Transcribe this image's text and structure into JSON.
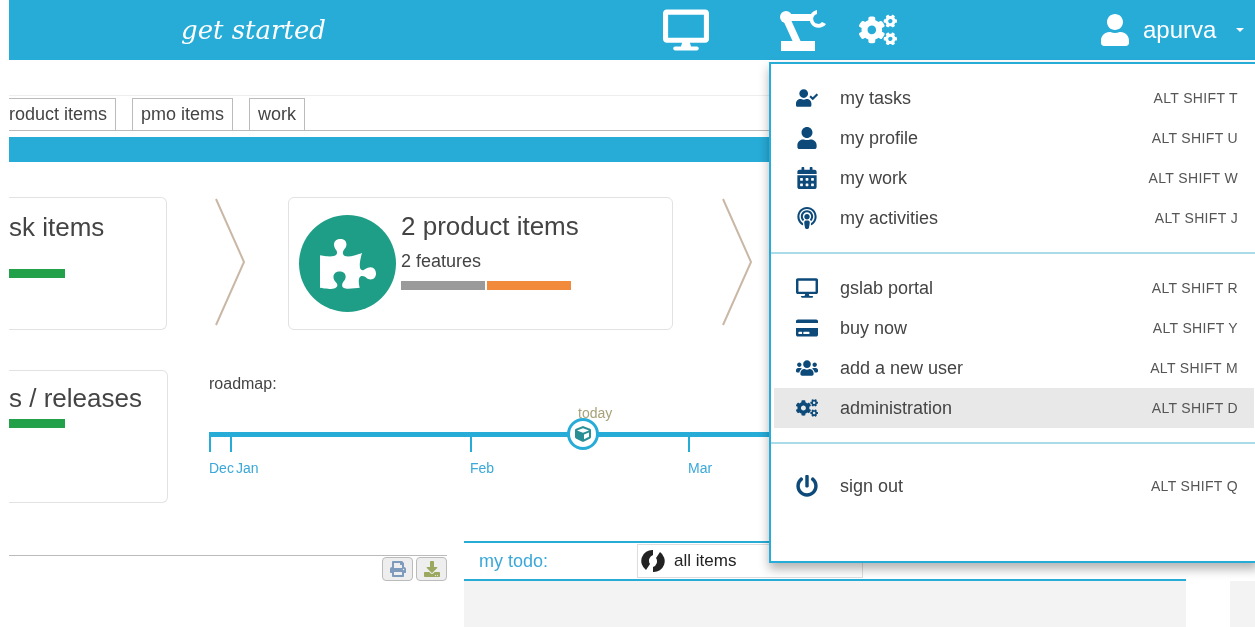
{
  "header": {
    "title": "get started",
    "user": "apurva"
  },
  "tabs": [
    {
      "label": "roduct items"
    },
    {
      "label": "pmo items"
    },
    {
      "label": "work"
    }
  ],
  "cards": [
    {
      "title": "sk items",
      "bar": [
        {
          "color": "#22a04a"
        }
      ]
    },
    {
      "title": "2 product items",
      "subtitle": "2 features",
      "bar": [
        {
          "color": "#9a9a9a"
        },
        {
          "color": "#f28a3c"
        }
      ]
    }
  ],
  "releases": {
    "title": "s / releases",
    "bar": [
      {
        "color": "#22a04a"
      }
    ]
  },
  "roadmap": {
    "label": "roadmap:",
    "months": [
      "Dec",
      "Jan",
      "Feb",
      "Mar"
    ],
    "today": "today"
  },
  "todo": {
    "label": "my todo:",
    "filter": "all items"
  },
  "menu": [
    [
      {
        "label": "my tasks",
        "shortcut": "ALT SHIFT T",
        "selected": false
      },
      {
        "label": "my profile",
        "shortcut": "ALT SHIFT U",
        "selected": false
      },
      {
        "label": "my work",
        "shortcut": "ALT SHIFT W",
        "selected": false
      },
      {
        "label": "my activities",
        "shortcut": "ALT SHIFT J",
        "selected": false
      }
    ],
    [
      {
        "label": "gslab portal",
        "shortcut": "ALT SHIFT R",
        "selected": false
      },
      {
        "label": "buy now",
        "shortcut": "ALT SHIFT Y",
        "selected": false
      },
      {
        "label": "add a new user",
        "shortcut": "ALT SHIFT M",
        "selected": false
      },
      {
        "label": "administration",
        "shortcut": "ALT SHIFT D",
        "selected": true
      }
    ],
    [
      {
        "label": "sign out",
        "shortcut": "ALT SHIFT Q",
        "selected": false
      }
    ]
  ]
}
